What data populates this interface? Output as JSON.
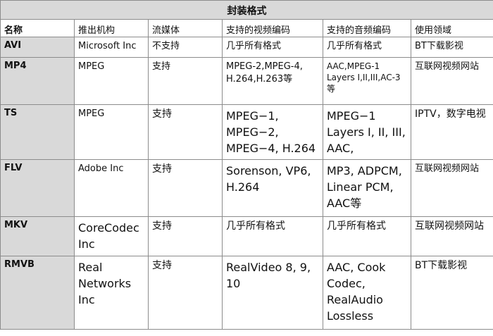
{
  "table": {
    "title": "封装格式",
    "headers": [
      "名称",
      "推出机构",
      "流媒体",
      "支持的视频编码",
      "支持的音频编码",
      "使用领域"
    ],
    "rows": [
      [
        "AVI",
        "Microsoft Inc",
        "不支持",
        "几乎所有格式",
        "几乎所有格式",
        "BT下载影视"
      ],
      [
        "MP4",
        "MPEG",
        "支持",
        "MPEG-2,MPEG-4, H.264,H.263等",
        "AAC,MPEG-1 Layers I,II,III,AC-3等",
        "互联网视频网站"
      ],
      [
        "TS",
        "MPEG",
        "支持",
        "MPEG−1, MPEG−2, MPEG−4, H.264",
        "MPEG−1 Layers I, II, III, AAC,",
        "IPTV，数字电视"
      ],
      [
        "FLV",
        "Adobe Inc",
        "支持",
        "Sorenson, VP6, H.264",
        "MP3, ADPCM, Linear PCM, AAC等",
        "互联网视频网站"
      ],
      [
        "MKV",
        "CoreCodec Inc",
        "支持",
        "几乎所有格式",
        "几乎所有格式",
        "互联网视频网站"
      ],
      [
        "RMVB",
        "Real Networks Inc",
        "支持",
        "RealVideo 8, 9, 10",
        "AAC, Cook Codec, RealAudio Lossless",
        "BT下载影视"
      ]
    ]
  }
}
